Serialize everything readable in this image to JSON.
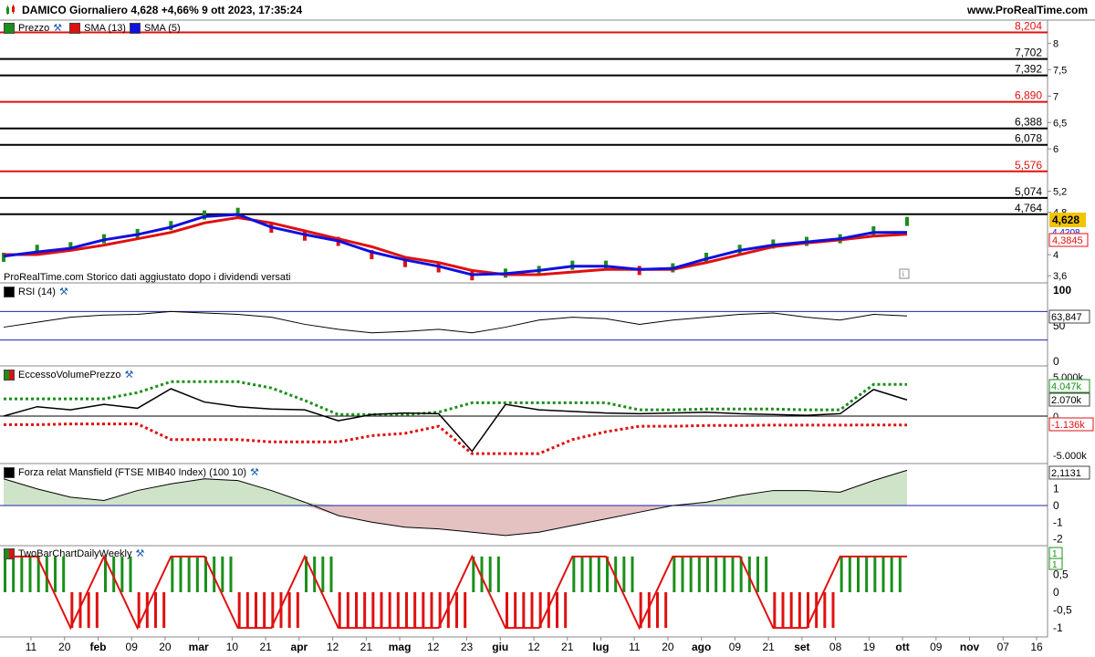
{
  "header": {
    "title": "DAMICO Giornaliero 4,628 +4,66% 9 ott 2023, 17:35:24",
    "site": "www.ProRealTime.com"
  },
  "price_panel": {
    "legend": [
      {
        "label": "Prezzo",
        "color": "#1a8f1a"
      },
      {
        "label": "SMA (13)",
        "color": "#e01010"
      },
      {
        "label": "SMA (5)",
        "color": "#1010e0"
      }
    ],
    "note": "ProRealTime.com Storico dati aggiustato dopo i dividendi versati",
    "last_price_label": "4,628",
    "sma5_label": "4,4208",
    "sma13_label": "4,3845",
    "level_labels": [
      "8,204",
      "7,702",
      "7,392",
      "6,890",
      "6,388",
      "6,078",
      "5,576",
      "5,074",
      "4,764"
    ]
  },
  "rsi_panel": {
    "legend": "RSI (14)",
    "value_label": "63,847",
    "tick_labels": [
      "100",
      "50",
      "0"
    ]
  },
  "volume_panel": {
    "legend": "EccessoVolumePrezzo",
    "upper_label": "4.047k",
    "mid_label": "2.070k",
    "lower_label": "-1.136k",
    "tick_labels": [
      "5.000k",
      "0",
      "-5.000k"
    ]
  },
  "mansfield_panel": {
    "legend": "Forza relat Mansfield (FTSE MIB40 Index) (100 10)",
    "value_label": "2,1131",
    "tick_labels": [
      "1",
      "0",
      "-1",
      "-2"
    ]
  },
  "twobar_panel": {
    "legend": "TwoBarChartDailyWeekly",
    "value_label_top": "1",
    "value_label_bottom": "1",
    "tick_labels": [
      "0,5",
      "0",
      "-0,5",
      "-1"
    ]
  },
  "x_axis": {
    "labels": [
      "11",
      "20",
      "feb",
      "09",
      "20",
      "mar",
      "10",
      "21",
      "apr",
      "12",
      "21",
      "mag",
      "12",
      "23",
      "giu",
      "12",
      "21",
      "lug",
      "11",
      "20",
      "ago",
      "09",
      "21",
      "set",
      "08",
      "19",
      "ott",
      "09",
      "nov",
      "07",
      "16"
    ]
  },
  "chart_data": [
    {
      "type": "line",
      "name": "price",
      "title": "DAMICO Giornaliero",
      "x": [
        "11",
        "20",
        "feb",
        "09",
        "20",
        "mar",
        "10",
        "21",
        "apr",
        "12",
        "21",
        "mag",
        "12",
        "23",
        "giu",
        "12",
        "21",
        "lug",
        "11",
        "20",
        "ago",
        "09",
        "21",
        "set",
        "08",
        "19",
        "ott",
        "09"
      ],
      "series": [
        {
          "name": "Prezzo",
          "values": [
            3.95,
            4.1,
            4.15,
            4.3,
            4.4,
            4.55,
            4.75,
            4.8,
            4.5,
            4.35,
            4.25,
            4.0,
            3.85,
            3.75,
            3.6,
            3.65,
            3.7,
            3.8,
            3.8,
            3.7,
            3.75,
            3.95,
            4.1,
            4.2,
            4.25,
            4.3,
            4.45,
            4.628
          ]
        },
        {
          "name": "SMA (13)",
          "values": [
            4.0,
            4.0,
            4.08,
            4.18,
            4.3,
            4.42,
            4.6,
            4.7,
            4.6,
            4.45,
            4.3,
            4.15,
            3.95,
            3.85,
            3.7,
            3.62,
            3.62,
            3.67,
            3.72,
            3.72,
            3.72,
            3.85,
            4.0,
            4.15,
            4.22,
            4.28,
            4.35,
            4.3845
          ]
        },
        {
          "name": "SMA (5)",
          "values": [
            3.97,
            4.05,
            4.12,
            4.28,
            4.38,
            4.52,
            4.72,
            4.76,
            4.52,
            4.38,
            4.26,
            4.05,
            3.9,
            3.78,
            3.62,
            3.64,
            3.7,
            3.78,
            3.78,
            3.72,
            3.74,
            3.92,
            4.08,
            4.18,
            4.24,
            4.3,
            4.42,
            4.4208
          ]
        }
      ],
      "levels": [
        8.204,
        7.702,
        7.392,
        6.89,
        6.388,
        6.078,
        5.576,
        5.074,
        4.764
      ],
      "level_colors": [
        "#e01010",
        "#000000",
        "#000000",
        "#e01010",
        "#000000",
        "#000000",
        "#e01010",
        "#000000",
        "#000000"
      ],
      "ylim": [
        3.5,
        8.3
      ],
      "yticks": [
        "8",
        "7,5",
        "7",
        "6,5",
        "6",
        "5,2",
        "4,8",
        "4",
        "3,6"
      ]
    },
    {
      "type": "line",
      "name": "rsi",
      "series": [
        {
          "name": "RSI (14)",
          "values": [
            48,
            55,
            62,
            65,
            66,
            70,
            68,
            66,
            62,
            52,
            45,
            40,
            42,
            45,
            40,
            48,
            58,
            62,
            60,
            52,
            58,
            62,
            66,
            68,
            62,
            58,
            66,
            63.847
          ]
        }
      ],
      "ylim": [
        0,
        100
      ],
      "yticks": [
        "100",
        "50",
        "0"
      ]
    },
    {
      "type": "line",
      "name": "volume_excess",
      "series": [
        {
          "name": "EccessoVolumePrezzo",
          "values": [
            0,
            1200,
            800,
            1500,
            1000,
            3500,
            1800,
            1200,
            900,
            800,
            -600,
            200,
            400,
            300,
            -4500,
            1500,
            800,
            600,
            400,
            300,
            400,
            500,
            300,
            200,
            100,
            300,
            3400,
            2070
          ]
        }
      ],
      "upper_band": [
        2200,
        2200,
        2200,
        2200,
        3000,
        4400,
        4400,
        4400,
        3600,
        2000,
        200,
        200,
        200,
        500,
        1700,
        1700,
        1700,
        1700,
        1700,
        800,
        800,
        900,
        900,
        900,
        800,
        800,
        4047,
        4047
      ],
      "lower_band": [
        -1100,
        -1100,
        -1000,
        -1000,
        -1000,
        -3000,
        -3000,
        -3000,
        -3300,
        -3300,
        -3300,
        -2500,
        -2200,
        -1300,
        -4800,
        -4800,
        -4800,
        -3000,
        -2000,
        -1300,
        -1300,
        -1200,
        -1200,
        -1150,
        -1150,
        -1150,
        -1136,
        -1136
      ],
      "ylim": [
        -5600,
        5600
      ],
      "yticks": [
        "5.000k",
        "0",
        "-5.000k"
      ]
    },
    {
      "type": "area",
      "name": "mansfield",
      "series": [
        {
          "name": "Forza relat Mansfield (FTSE MIB40 Index) (100 10)",
          "values": [
            1.6,
            1.0,
            0.5,
            0.3,
            0.9,
            1.3,
            1.6,
            1.5,
            0.9,
            0.2,
            -0.6,
            -1.0,
            -1.3,
            -1.4,
            -1.6,
            -1.8,
            -1.6,
            -1.2,
            -0.8,
            -0.4,
            0.0,
            0.2,
            0.6,
            0.9,
            0.9,
            0.8,
            1.5,
            2.1131
          ]
        }
      ],
      "ylim": [
        -2.3,
        2.3
      ],
      "yticks": [
        "1",
        "0",
        "-1",
        "-2"
      ]
    },
    {
      "type": "bar",
      "name": "twobar",
      "series": [
        {
          "name": "TwoBarChartDailyWeekly",
          "values": [
            1,
            1,
            -1,
            1,
            -1,
            1,
            1,
            -1,
            -1,
            1,
            -1,
            -1,
            -1,
            -1,
            1,
            -1,
            -1,
            1,
            1,
            -1,
            1,
            1,
            1,
            -1,
            -1,
            1,
            1,
            1
          ]
        }
      ],
      "ylim": [
        -1.2,
        1.2
      ],
      "yticks": [
        "0,5",
        "0",
        "-0,5",
        "-1"
      ]
    }
  ]
}
